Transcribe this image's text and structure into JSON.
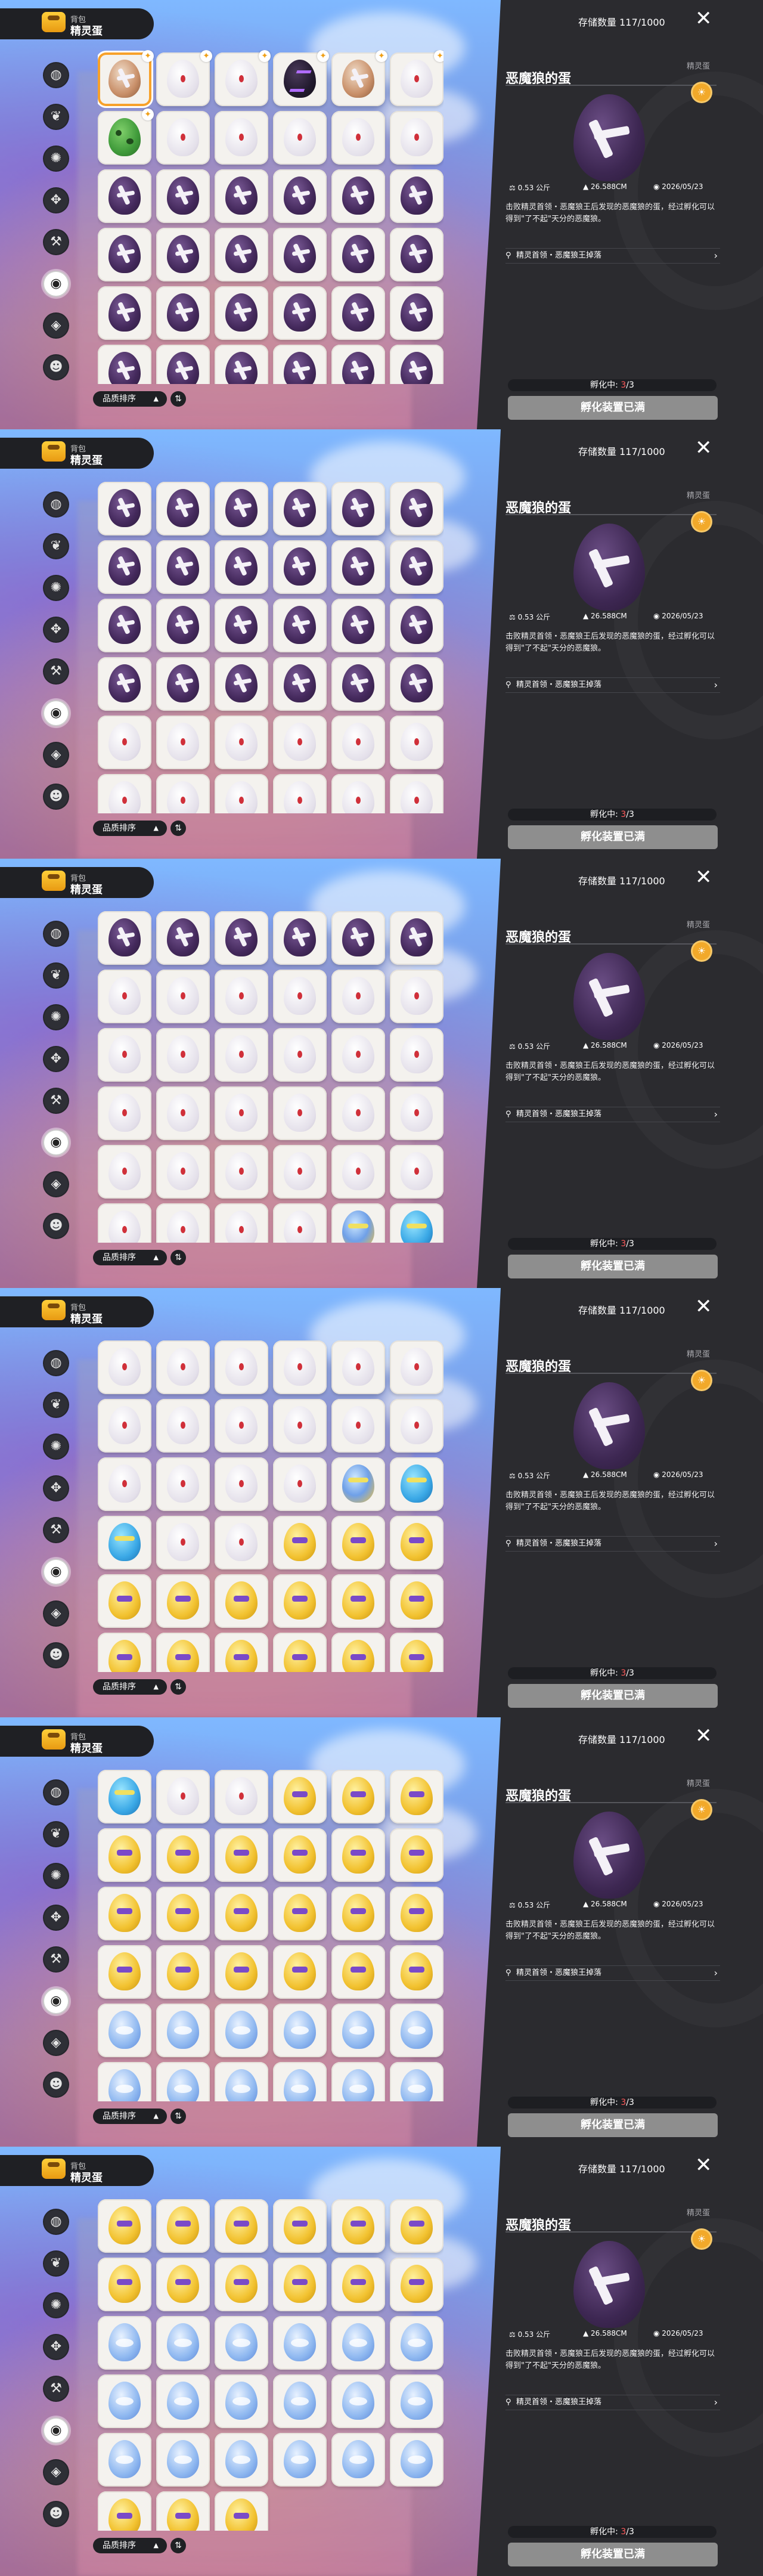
{
  "header": {
    "small": "背包",
    "big": "精灵蛋"
  },
  "sidebar": {
    "icons": [
      "bag-icon",
      "leaf-icon",
      "fire-icon",
      "claw-icon",
      "tool-icon",
      "egg-icon",
      "pot-icon",
      "face-icon"
    ],
    "active": 5
  },
  "sort": {
    "label": "品质排序",
    "arrow": "▲",
    "toggle_icon": "⇅"
  },
  "storage": {
    "label": "存储数量 117/1000"
  },
  "close_icon": "✕",
  "detail": {
    "name": "恶魔狼的蛋",
    "type_tag": "精灵蛋",
    "medal_icon": "☀",
    "weight": "0.53",
    "weight_unit": "公斤",
    "size": "26.588",
    "size_unit": "CM",
    "date": "2026/05/23",
    "description": "击败精灵首领・恶魔狼王后发现的恶魔狼的蛋，经过孵化可以得到\"了不起\"天分的恶魔狼。",
    "source": "精灵首领・恶魔狼王掉落",
    "hatch_label": "孵化中: ",
    "hatch_current": "3",
    "hatch_total": "/3",
    "button_label": "孵化装置已满"
  },
  "colors": {
    "accent": "#f7a12a",
    "panel": "#2b2b2f",
    "highlight_red": "#ff5a5a"
  },
  "frames": [
    {
      "rows": [
        "X W W S X W",
        "G W W W W W",
        "D D D D D D",
        "D D D D D D",
        "D D D D D D",
        "D D D D D D"
      ],
      "selected": [
        0,
        0
      ],
      "badges": [
        [
          0,
          0
        ],
        [
          0,
          1
        ],
        [
          0,
          2
        ],
        [
          0,
          3
        ],
        [
          0,
          4
        ],
        [
          0,
          5
        ],
        [
          1,
          0
        ]
      ]
    },
    {
      "rows": [
        "D D D D D D",
        "D D D D D D",
        "D D D D D D",
        "D D D D D D",
        "W W W W W W",
        "W W W W W W"
      ],
      "selected": [
        0,
        0
      ],
      "badges": []
    },
    {
      "rows": [
        "D D D D D D",
        "W W W W W W",
        "W W W W W W",
        "W W W W W W",
        "W W W W W W",
        "W W W W B C"
      ],
      "selected": [
        0,
        0
      ],
      "badges": []
    },
    {
      "rows": [
        "W W W W W W",
        "W W W W W W",
        "W W W W B C",
        "C W W Y Y Y",
        "Y Y Y Y Y Y",
        "Y Y Y Y Y Y"
      ],
      "selected": [
        0,
        0
      ],
      "badges": []
    },
    {
      "rows": [
        "C W W Y Y Y",
        "Y Y Y Y Y Y",
        "Y Y Y Y Y Y",
        "Y Y Y Y Y Y",
        "L L L L L L",
        "L L L L L L"
      ],
      "selected": [
        0,
        0
      ],
      "badges": []
    },
    {
      "rows": [
        "Y Y Y Y Y Y",
        "Y Y Y Y Y Y",
        "L L L L L L",
        "L L L L L L",
        "L L L L L L",
        "Y Y Y"
      ],
      "selected": [
        0,
        0
      ],
      "badges": []
    }
  ]
}
